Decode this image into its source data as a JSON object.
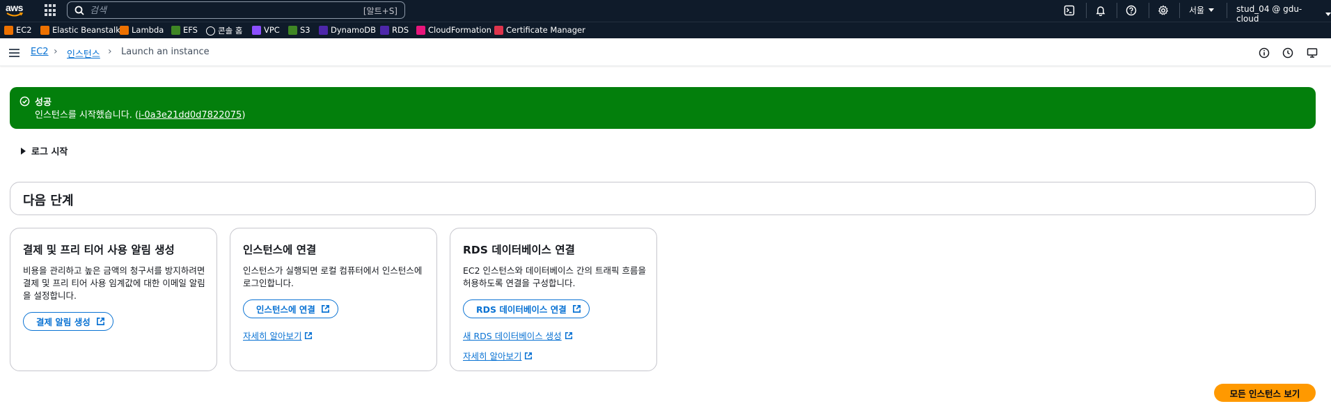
{
  "topnav": {
    "logo_text": "aws",
    "search_placeholder": "검색",
    "search_shortcut": "[알트+S]",
    "region": "서울",
    "account": "stud_04 @ gdu-cloud"
  },
  "favorites": [
    {
      "label": "EC2",
      "color": "#ed7100",
      "icon": "ec2-icon"
    },
    {
      "label": "Elastic Beanstalk",
      "color": "#ed7100",
      "icon": "elastic-beanstalk-icon"
    },
    {
      "label": "Lambda",
      "color": "#ed7100",
      "icon": "lambda-icon"
    },
    {
      "label": "EFS",
      "color": "#3f8624",
      "icon": "efs-icon"
    },
    {
      "label": "콘솔 홈",
      "color": "#0f1b2a",
      "icon": "console-home-icon"
    },
    {
      "label": "VPC",
      "color": "#8c4fff",
      "icon": "vpc-icon"
    },
    {
      "label": "S3",
      "color": "#3f8624",
      "icon": "s3-icon"
    },
    {
      "label": "DynamoDB",
      "color": "#4d27aa",
      "icon": "dynamodb-icon"
    },
    {
      "label": "RDS",
      "color": "#4d27aa",
      "icon": "rds-icon"
    },
    {
      "label": "CloudFormation",
      "color": "#e7157b",
      "icon": "cloudformation-icon"
    },
    {
      "label": "Certificate Manager",
      "color": "#dd344c",
      "icon": "certificate-manager-icon"
    }
  ],
  "breadcrumb": {
    "items": [
      "EC2",
      "인스턴스",
      "Launch an instance"
    ]
  },
  "flash": {
    "title": "성공",
    "message_prefix": "인스턴스를 시작했습니다. (",
    "instance_id": "i-0a3e21dd0d7822075",
    "message_suffix": ")",
    "color": "#037f0c"
  },
  "log": {
    "label": "로그 시작"
  },
  "next_steps": {
    "title": "다음 단계",
    "cards": [
      {
        "title": "결제 및 프리 티어 사용 알림 생성",
        "description": "비용을 관리하고 높은 금액의 청구서를 방지하려면 결제 및 프리 티어 사용 임계값에 대한 이메일 알림을 설정합니다.",
        "button": "결제 알림 생성",
        "links": []
      },
      {
        "title": "인스턴스에 연결",
        "description": "인스턴스가 실행되면 로컬 컴퓨터에서 인스턴스에 로그인합니다.",
        "button": "인스턴스에 연결",
        "links": [
          "자세히 알아보기"
        ]
      },
      {
        "title": "RDS 데이터베이스 연결",
        "description": "EC2 인스턴스와 데이터베이스 간의 트래픽 흐름을 허용하도록 연결을 구성합니다.",
        "button": "RDS 데이터베이스 연결",
        "links": [
          "새 RDS 데이터베이스 생성",
          "자세히 알아보기"
        ]
      }
    ]
  },
  "primary_action": {
    "label": "모든 인스턴스 보기",
    "color": "#ff9900"
  }
}
